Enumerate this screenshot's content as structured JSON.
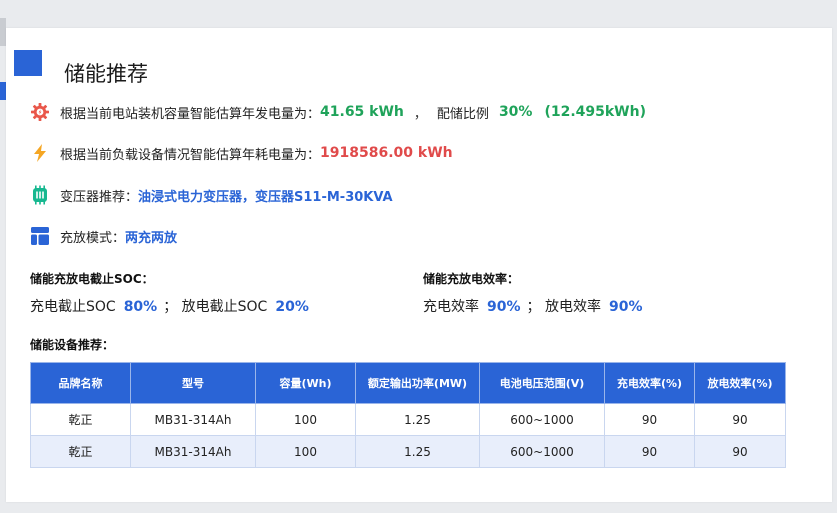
{
  "page": {
    "title": "储能推荐"
  },
  "info": {
    "generation": {
      "label": "根据当前电站装机容量智能估算年发电量为：",
      "value": "41.65 kWh",
      "sep": "，",
      "ratio_label": "配储比例",
      "ratio_value": "30%",
      "ratio_detail": "(12.495kWh)"
    },
    "consumption": {
      "label": "根据当前负载设备情况智能估算年耗电量为：",
      "value": "1918586.00 kWh"
    },
    "transformer": {
      "label": "变压器推荐：",
      "value": "油浸式电力变压器，变压器S11-M-30KVA"
    },
    "mode": {
      "label": "充放模式：",
      "value": "两充两放"
    }
  },
  "soc": {
    "heading": "储能充放电截止SOC：",
    "charge_label": "充电截止SOC",
    "charge_value": "80%",
    "separator": "；",
    "discharge_label": "放电截止SOC",
    "discharge_value": "20%"
  },
  "efficiency": {
    "heading": "储能充放电效率：",
    "charge_label": "充电效率",
    "charge_value": "90%",
    "separator": "；",
    "discharge_label": "放电效率",
    "discharge_value": "90%"
  },
  "equipment": {
    "heading": "储能设备推荐：",
    "columns": [
      "品牌名称",
      "型号",
      "容量(Wh)",
      "额定输出功率(MW)",
      "电池电压范围(V)",
      "充电效率(%)",
      "放电效率(%)"
    ],
    "rows": [
      [
        "乾正",
        "MB31-314Ah",
        "100",
        "1.25",
        "600~1000",
        "90",
        "90"
      ],
      [
        "乾正",
        "MB31-314Ah",
        "100",
        "1.25",
        "600~1000",
        "90",
        "90"
      ]
    ]
  },
  "icons": {
    "generation": "gear-icon",
    "consumption": "lightning-icon",
    "transformer": "chip-icon",
    "mode": "layout-icon"
  },
  "colors": {
    "accent_blue": "#2a64d6",
    "green": "#1fa35a",
    "red": "#e04a4a",
    "orange": "#f5a623",
    "teal": "#17b890",
    "gear_red": "#e9574a"
  }
}
